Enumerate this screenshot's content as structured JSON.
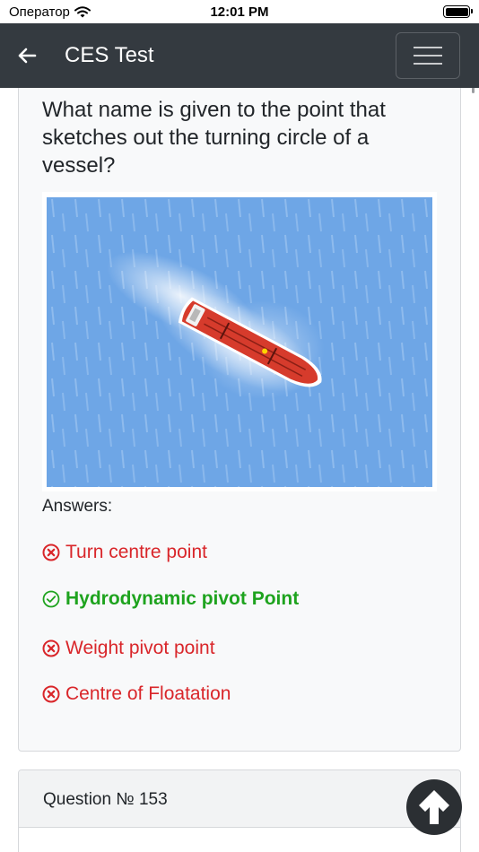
{
  "status_bar": {
    "carrier": "Оператор",
    "time": "12:01 PM"
  },
  "nav": {
    "title": "CES Test"
  },
  "question": {
    "text": "What name is given to the point that sketches out the turning circle of a vessel?",
    "image_icon": "ship-turning-illustration"
  },
  "answers": {
    "label": "Answers:",
    "items": [
      {
        "text": "Turn centre point",
        "correct": false,
        "icon": "x-circle-icon"
      },
      {
        "text": "Hydrodynamic pivot Point",
        "correct": true,
        "icon": "check-circle-icon"
      },
      {
        "text": "Weight pivot point",
        "correct": false,
        "icon": "x-circle-icon"
      },
      {
        "text": "Centre of Floatation",
        "correct": false,
        "icon": "x-circle-icon"
      }
    ]
  },
  "next_question": {
    "label": "Question № 153"
  },
  "colors": {
    "navbar": "#343a40",
    "correct": "#1ea31e",
    "wrong": "#d9262a",
    "sea": "#6ea6e6",
    "ship_hull": "#d63b2c"
  }
}
